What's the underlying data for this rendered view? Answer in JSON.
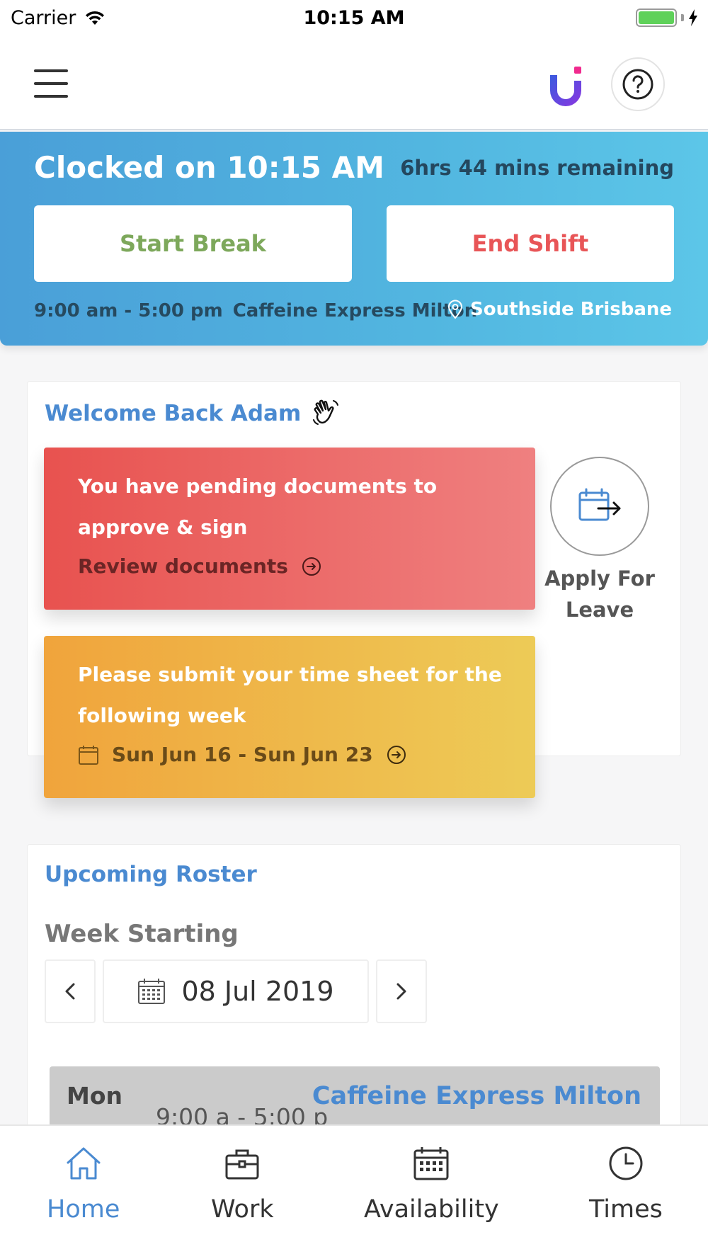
{
  "status_bar": {
    "carrier": "Carrier",
    "time": "10:15 AM"
  },
  "header": {
    "icons": [
      "menu-icon",
      "brand-logo",
      "help-icon"
    ],
    "logo_colors": [
      "#3a5bdf",
      "#8a36e0",
      "#f02a8e"
    ]
  },
  "clock": {
    "prefix": "Clocked on",
    "time": "10:15 AM",
    "remaining": "6hrs 44 mins remaining",
    "start_break_label": "Start Break",
    "end_shift_label": "End Shift",
    "shift_hours": "9:00 am - 5:00 pm",
    "shift_venue": "Caffeine Express Milton",
    "shift_location": "Southside Brisbane",
    "colors": {
      "banner_start": "#4a9fd8",
      "banner_end": "#5cc6e8",
      "break": "#7da85b",
      "end": "#e85557"
    }
  },
  "welcome": {
    "title": "Welcome Back Adam",
    "docs_alert": {
      "text": "You have pending documents to approve & sign",
      "link": "Review documents"
    },
    "timesheet_alert": {
      "text": "Please submit your time sheet for the following week",
      "link": "Sun Jun 16 - Sun Jun 23"
    },
    "leave_label": "Apply For Leave"
  },
  "roster": {
    "title": "Upcoming Roster",
    "week_label": "Week Starting",
    "week_date": "08 Jul 2019",
    "rows": [
      {
        "day": "Mon",
        "time": "9:00 a - 5:00 p",
        "venue": "Caffeine Express Milton"
      }
    ]
  },
  "tabs": [
    {
      "label": "Home",
      "icon": "home-icon",
      "active": true
    },
    {
      "label": "Work",
      "icon": "briefcase-icon",
      "active": false
    },
    {
      "label": "Availability",
      "icon": "calendar-icon",
      "active": false
    },
    {
      "label": "Times",
      "icon": "clock-icon",
      "active": false
    }
  ]
}
